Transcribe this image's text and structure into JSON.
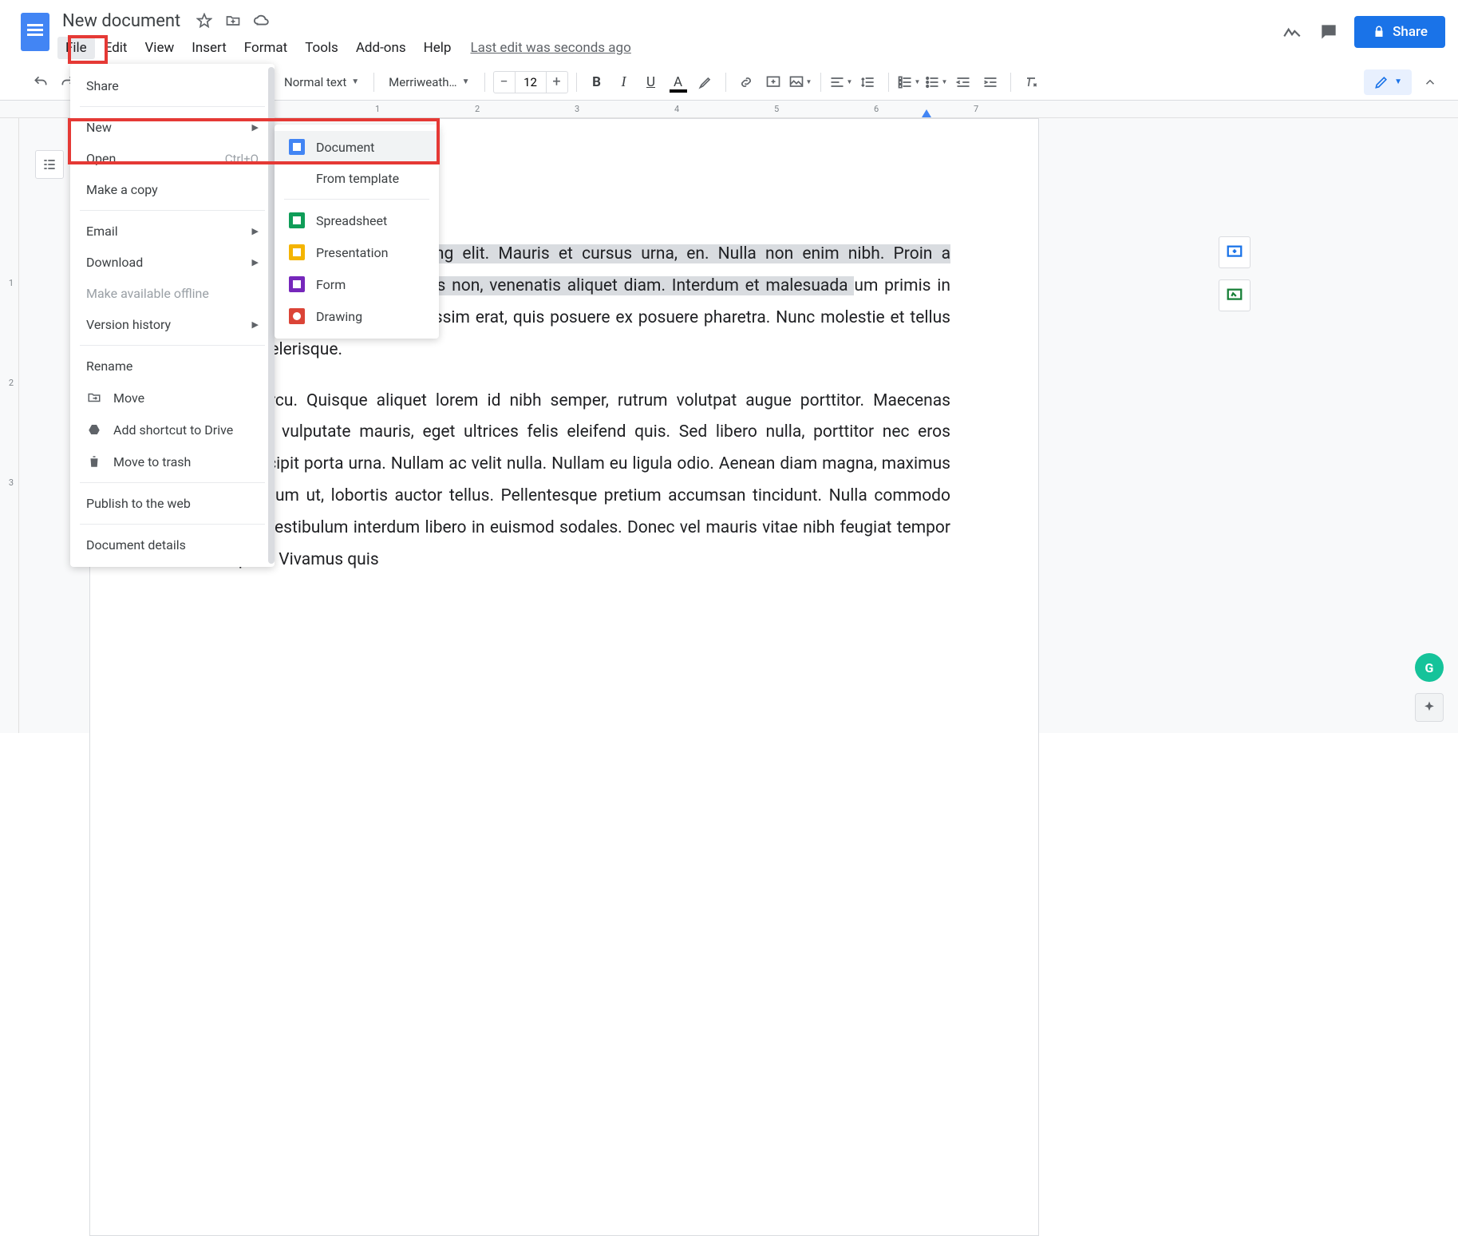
{
  "title": "New document",
  "menubar": [
    "File",
    "Edit",
    "View",
    "Insert",
    "Format",
    "Tools",
    "Add-ons",
    "Help"
  ],
  "last_edit": "Last edit was seconds ago",
  "share_label": "Share",
  "toolbar": {
    "style": "Normal text",
    "font": "Merriweath…",
    "font_size": "12"
  },
  "ruler": {
    "labels": [
      "1",
      "2",
      "3",
      "4",
      "5",
      "6",
      "7"
    ]
  },
  "vruler": [
    "1",
    "2",
    "3"
  ],
  "file_menu": {
    "share": "Share",
    "new": "New",
    "open": "Open",
    "open_shortcut": "Ctrl+O",
    "make_copy": "Make a copy",
    "email": "Email",
    "download": "Download",
    "offline": "Make available offline",
    "version": "Version history",
    "rename": "Rename",
    "move": "Move",
    "shortcut": "Add shortcut to Drive",
    "trash": "Move to trash",
    "publish": "Publish to the web",
    "details": "Document details"
  },
  "new_submenu": {
    "document": "Document",
    "template": "From template",
    "spreadsheet": "Spreadsheet",
    "presentation": "Presentation",
    "form": "Form",
    "drawing": "Drawing"
  },
  "document": {
    "p1_hl": "or sit amet, consectetur adipiscing elit. Mauris et cursus urna, en. Nulla non enim nibh. Proin a dignissim dolor. Nunc quam d felis non, venenatis aliquet diam. Interdum et malesuada ",
    "p1_mid": "um primis in faucibus. ",
    "p1_rest": "Maecenas facilisis dignissim erat, quis posuere ex posuere pharetra. Nunc molestie et tellus imperdiet scelerisque.",
    "p2": "In a urna arcu. Quisque aliquet lorem id nibh semper, rutrum volutpat augue porttitor. Maecenas pellentesque vulputate mauris, eget ultrices felis eleifend quis. Sed libero nulla, porttitor nec eros ultrices, suscipit porta urna. Nullam ac velit nulla. Nullam eu ligula odio. Aenean diam magna, maximus eget vestibulum ut, lobortis auctor tellus. Pellentesque pretium accumsan tincidunt. Nulla commodo felis tortor. Vestibulum interdum libero in euismod sodales. Donec vel mauris vitae nibh feugiat tempor vel id sapien. Vivamus quis"
  }
}
